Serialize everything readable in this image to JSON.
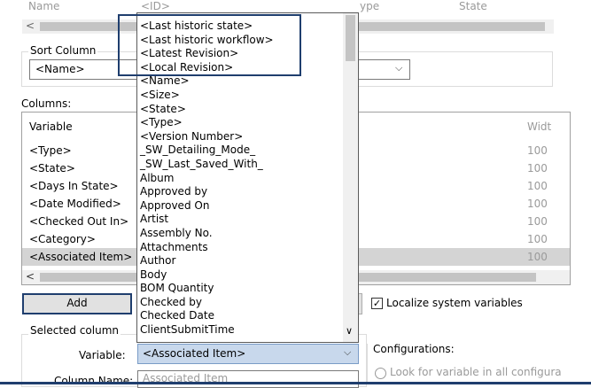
{
  "top_header": {
    "name": "Name",
    "id": "<ID>",
    "type": "ype",
    "state": "State"
  },
  "sort_column": {
    "label": "Sort Column",
    "value": "<Name>"
  },
  "columns_label": "Columns:",
  "columns_table": {
    "header_variable": "Variable",
    "header_width": "Widt",
    "rows": [
      {
        "name": "<Type>",
        "width": "100"
      },
      {
        "name": "<State>",
        "width": "100"
      },
      {
        "name": "<Days In State>",
        "width": "100"
      },
      {
        "name": "<Date Modified>",
        "width": "100"
      },
      {
        "name": "<Checked Out In>",
        "width": "100"
      },
      {
        "name": "<Category>",
        "width": "100"
      },
      {
        "name": "<Associated Item>",
        "width": "100"
      }
    ]
  },
  "add_button": "Add",
  "localize_label": "Localize system variables",
  "localize_checked": "✓",
  "selected_column": {
    "label": "Selected column",
    "variable_label": "Variable:",
    "variable_value": "<Associated Item>",
    "column_name_label": "Column Name:",
    "column_name_value": "Associated Item"
  },
  "configurations": {
    "label": "Configurations:",
    "option": "Look for variable in all configura"
  },
  "dropdown_items": [
    "<Last historic state>",
    "<Last historic workflow>",
    "<Latest Revision>",
    "<Local Revision>",
    "<Name>",
    "<Size>",
    "<State>",
    "<Type>",
    "<Version Number>",
    "_SW_Detailing_Mode_",
    "_SW_Last_Saved_With_",
    "Album",
    "Approved by",
    "Approved On",
    "Artist",
    "Assembly No.",
    "Attachments",
    "Author",
    "Body",
    "BOM Quantity",
    "Checked by",
    "Checked Date",
    "ClientSubmitTime"
  ],
  "icons": {
    "chevron": "⌵",
    "scroll_left": "<",
    "scroll_up": "∧",
    "scroll_down": "∨"
  },
  "colors": {
    "highlight_border": "#1f3e6e",
    "selected_combo": "#c8d8ec",
    "selected_row": "#d4d4d4"
  }
}
